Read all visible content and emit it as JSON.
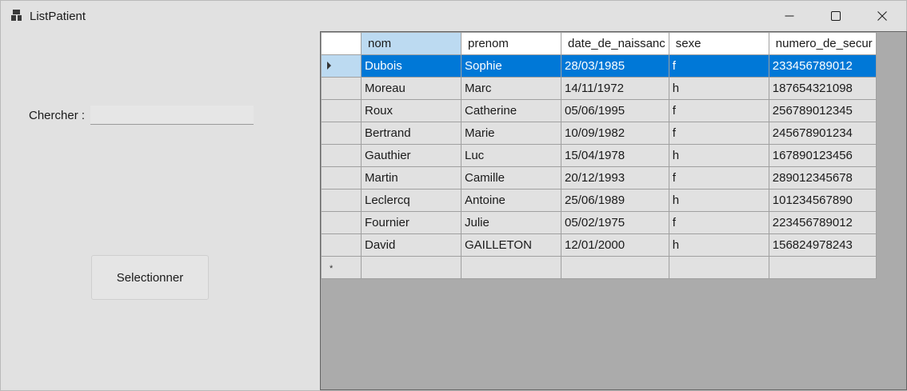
{
  "window": {
    "title": "ListPatient"
  },
  "search": {
    "label": "Chercher :",
    "value": "",
    "placeholder": ""
  },
  "select_button": {
    "label": "Selectionner"
  },
  "grid": {
    "columns": [
      "nom",
      "prenom",
      "date_de_naissanc",
      "sexe",
      "numero_de_secur"
    ],
    "selected_column": "nom",
    "selected_row": 0,
    "rows": [
      [
        "Dubois",
        "Sophie",
        "28/03/1985",
        "f",
        "233456789012"
      ],
      [
        "Moreau",
        "Marc",
        "14/11/1972",
        "h",
        "187654321098"
      ],
      [
        "Roux",
        "Catherine",
        "05/06/1995",
        "f",
        "256789012345"
      ],
      [
        "Bertrand",
        "Marie",
        "10/09/1982",
        "f",
        "245678901234"
      ],
      [
        "Gauthier",
        "Luc",
        "15/04/1978",
        "h",
        "167890123456"
      ],
      [
        "Martin",
        "Camille",
        "20/12/1993",
        "f",
        "289012345678"
      ],
      [
        "Leclercq",
        "Antoine",
        "25/06/1989",
        "h",
        "101234567890"
      ],
      [
        "Fournier",
        "Julie",
        "05/02/1975",
        "f",
        "223456789012"
      ],
      [
        "David",
        "GAILLETON",
        "12/01/2000",
        "h",
        "156824978243"
      ]
    ],
    "new_row_marker": "*"
  },
  "icons": {
    "app": "app-icon",
    "minimize": "minimize-icon",
    "maximize": "maximize-icon",
    "close": "close-icon",
    "row_current": "triangle-right-icon",
    "row_new": "asterisk-icon"
  },
  "colors": {
    "selection": "#0078d7",
    "header_selected": "#bcdaf1",
    "grid_background": "#ababab",
    "window": "#e1e1e1"
  }
}
